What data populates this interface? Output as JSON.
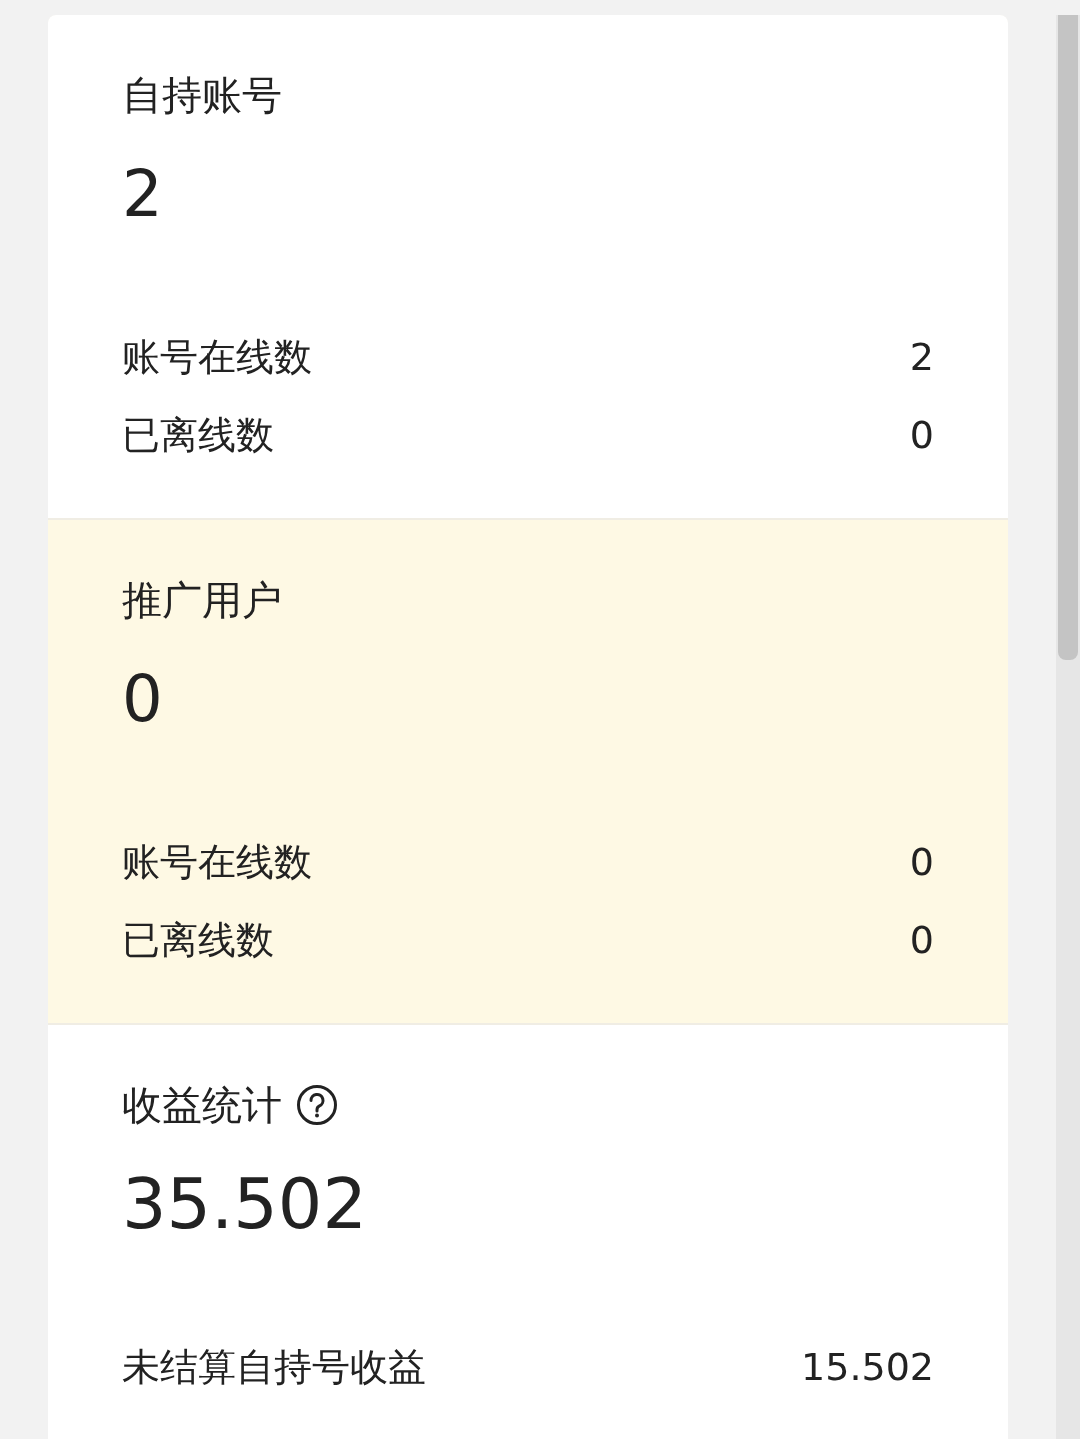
{
  "sections": [
    {
      "title": "自持账号",
      "value": "2",
      "highlighted": false,
      "help": false,
      "rows": [
        {
          "label": "账号在线数",
          "value": "2"
        },
        {
          "label": "已离线数",
          "value": "0"
        }
      ]
    },
    {
      "title": "推广用户",
      "value": "0",
      "highlighted": true,
      "help": false,
      "rows": [
        {
          "label": "账号在线数",
          "value": "0"
        },
        {
          "label": "已离线数",
          "value": "0"
        }
      ]
    },
    {
      "title": "收益统计",
      "value": "35.502",
      "highlighted": false,
      "help": true,
      "rows": [
        {
          "label": "未结算自持号收益",
          "value": "15.502"
        }
      ]
    }
  ]
}
